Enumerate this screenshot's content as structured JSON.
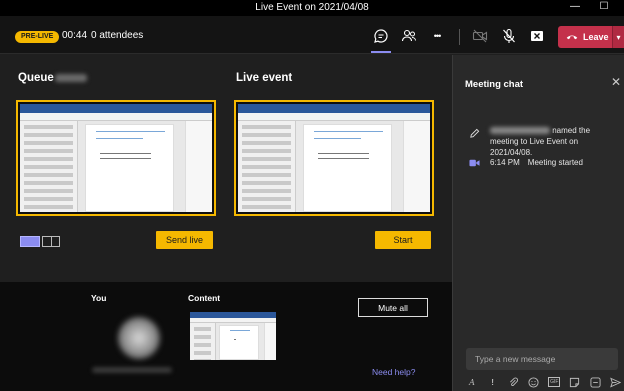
{
  "window": {
    "title": "Live Event on 2021/04/08",
    "minimize": "—",
    "maximize": "☐",
    "close": "✕"
  },
  "toolbar": {
    "status_badge": "PRE-LIVE",
    "timer": "00:44",
    "attendees": "0 attendees",
    "more": "•••",
    "leave_label": "Leave",
    "leave_caret": "▾"
  },
  "producer": {
    "queue_title": "Queue",
    "live_title": "Live event",
    "send_live_label": "Send live",
    "start_label": "Start"
  },
  "bottom": {
    "you_label": "You",
    "content_label": "Content",
    "mute_all_label": "Mute all",
    "help_label": "Need help?"
  },
  "chat": {
    "title": "Meeting chat",
    "close": "✕",
    "msg1_text": "named the meeting to Live Event on 2021/04/08.",
    "msg2_time": "6:14 PM",
    "msg2_text": "Meeting started",
    "input_placeholder": "Type a new message",
    "tools": {
      "format": "A",
      "important": "!",
      "gif": "GIF"
    }
  },
  "colors": {
    "accent": "#8b8cf0",
    "prelive": "#f5b800",
    "leave": "#c4314b",
    "preview_border": "#f5b800"
  },
  "icons": [
    "chat-icon",
    "participants-icon",
    "more-icon",
    "camera-off-icon",
    "mic-off-icon",
    "share-off-icon",
    "phone-icon",
    "pencil-icon",
    "meeting-icon",
    "format-icon",
    "important-icon",
    "attach-icon",
    "emoji-icon",
    "gif-icon",
    "sticker-icon",
    "more-options-icon",
    "send-icon"
  ]
}
